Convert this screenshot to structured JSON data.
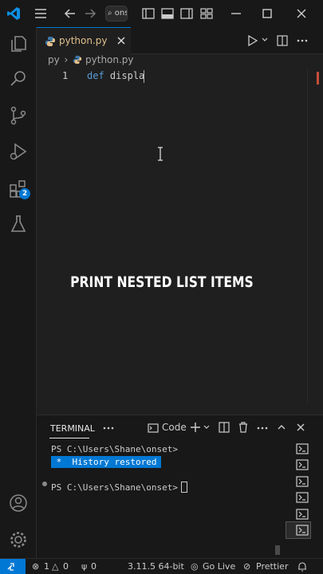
{
  "titlebar": {
    "command_center_text": "⌕ ons"
  },
  "activity": {
    "extensions_badge": "2"
  },
  "tab": {
    "label": "python.py"
  },
  "breadcrumb": {
    "folder": "py",
    "file": "python.py"
  },
  "editor": {
    "line_number": "1",
    "keyword": "def",
    "identifier": "displa"
  },
  "caption": "PRINT NESTED LIST ITEMS",
  "panel": {
    "terminal_tab": "TERMINAL",
    "terminal_profile": "Code",
    "prompt1": "PS C:\\Users\\Shane\\onset>",
    "history_text": " *  History restored ",
    "prompt2": "PS C:\\Users\\Shane\\onset>"
  },
  "statusbar": {
    "errors": "1",
    "warnings": "0",
    "ports": "0",
    "python_version": "3.11.5 64-bit",
    "go_live": "Go Live",
    "prettier": "Prettier"
  },
  "colors": {
    "accent": "#0078d4",
    "python_tab_text": "#e2c08d",
    "background": "#1f1f1f"
  }
}
